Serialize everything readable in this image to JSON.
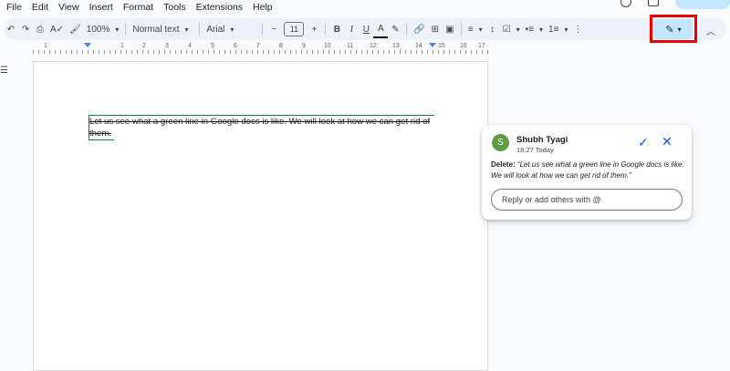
{
  "menu": [
    "File",
    "Edit",
    "View",
    "Insert",
    "Format",
    "Tools",
    "Extensions",
    "Help"
  ],
  "toolbar": {
    "zoom": "100%",
    "style": "Normal text",
    "font": "Arial",
    "font_size": "11"
  },
  "ruler": {
    "numbers": [
      "1",
      "1",
      "2",
      "3",
      "4",
      "5",
      "6",
      "7",
      "8",
      "9",
      "10",
      "11",
      "12",
      "13",
      "14",
      "15",
      "16",
      "17",
      "18"
    ]
  },
  "document": {
    "text": "Let us see what a green line in Google docs is like. We will look at how we can get rid of them."
  },
  "comment": {
    "avatar_letter": "S",
    "author": "Shubh Tyagi",
    "time": "18:27 Today",
    "label": "Delete:",
    "quote": "“Let us see what a green line in Google docs is like. We will look at how we can get rid of them.”",
    "reply_placeholder": "Reply or add others with @"
  },
  "colors": {
    "suggestion_green": "#188038",
    "avatar": "#5c9e44",
    "accent": "#0b57d0",
    "highlight_red": "#e00000"
  }
}
